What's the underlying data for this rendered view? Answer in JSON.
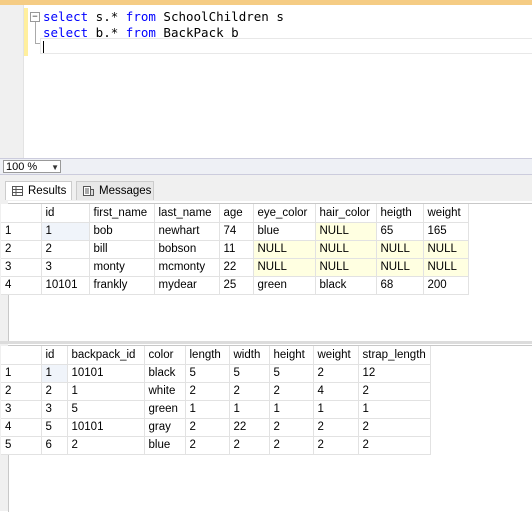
{
  "editor": {
    "line1": {
      "kw1": "select",
      "mid": " s.* ",
      "kw2": "from",
      "rest": " SchoolChildren s"
    },
    "line2": {
      "kw1": "select",
      "mid": " b.* ",
      "kw2": "from",
      "rest": " BackPack b"
    }
  },
  "zoom": {
    "value": "100 %"
  },
  "tabs": {
    "results": "Results",
    "messages": "Messages"
  },
  "grid1": {
    "headers": [
      "id",
      "first_name",
      "last_name",
      "age",
      "eye_color",
      "hair_color",
      "heigth",
      "weight"
    ],
    "rows": [
      {
        "n": "1",
        "cells": [
          "1",
          "bob",
          "newhart",
          "74",
          "blue",
          "NULL",
          "65",
          "165"
        ]
      },
      {
        "n": "2",
        "cells": [
          "2",
          "bill",
          "bobson",
          "11",
          "NULL",
          "NULL",
          "NULL",
          "NULL"
        ]
      },
      {
        "n": "3",
        "cells": [
          "3",
          "monty",
          "mcmonty",
          "22",
          "NULL",
          "NULL",
          "NULL",
          "NULL"
        ]
      },
      {
        "n": "4",
        "cells": [
          "10101",
          "frankly",
          "mydear",
          "25",
          "green",
          "black",
          "68",
          "200"
        ]
      }
    ]
  },
  "grid2": {
    "headers": [
      "id",
      "backpack_id",
      "color",
      "length",
      "width",
      "height",
      "weight",
      "strap_length"
    ],
    "rows": [
      {
        "n": "1",
        "cells": [
          "1",
          "10101",
          "black",
          "5",
          "5",
          "5",
          "2",
          "12"
        ]
      },
      {
        "n": "2",
        "cells": [
          "2",
          "1",
          "white",
          "2",
          "2",
          "2",
          "4",
          "2"
        ]
      },
      {
        "n": "3",
        "cells": [
          "3",
          "5",
          "green",
          "1",
          "1",
          "1",
          "1",
          "1"
        ]
      },
      {
        "n": "4",
        "cells": [
          "5",
          "10101",
          "gray",
          "2",
          "22",
          "2",
          "2",
          "2"
        ]
      },
      {
        "n": "5",
        "cells": [
          "6",
          "2",
          "blue",
          "2",
          "2",
          "2",
          "2",
          "2"
        ]
      }
    ]
  }
}
